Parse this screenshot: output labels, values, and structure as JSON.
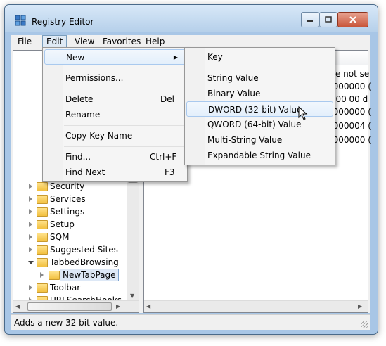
{
  "window": {
    "title": "Registry Editor",
    "min_icon": "minimize-icon",
    "max_icon": "maximize-icon",
    "close_icon": "close-icon"
  },
  "menubar": {
    "items": [
      "File",
      "Edit",
      "View",
      "Favorites",
      "Help"
    ]
  },
  "edit_menu": {
    "new": "New",
    "permissions": "Permissions...",
    "delete": "Delete",
    "delete_accel": "Del",
    "rename": "Rename",
    "copy_key_name": "Copy Key Name",
    "find": "Find...",
    "find_accel": "Ctrl+F",
    "find_next": "Find Next",
    "find_next_accel": "F3"
  },
  "new_submenu": {
    "key": "Key",
    "string_value": "String Value",
    "binary_value": "Binary Value",
    "dword_value": "DWORD (32-bit) Value",
    "qword_value": "QWORD (64-bit) Value",
    "multi_string_value": "Multi-String Value",
    "expandable_string_value": "Expandable String Value"
  },
  "tree": {
    "items": [
      "Security",
      "Services",
      "Settings",
      "Setup",
      "SQM",
      "Suggested Sites",
      "TabbedBrowsing",
      "NewTabPage",
      "Toolbar",
      "URLSearchHooks"
    ]
  },
  "list": {
    "header_fragment": "a",
    "rows": [
      "lue not se",
      "0000000 (",
      "0 00 00 d",
      "0000000 (",
      "0000004 (",
      "0000000 ("
    ]
  },
  "status": {
    "text": "Adds a new 32 bit value."
  }
}
